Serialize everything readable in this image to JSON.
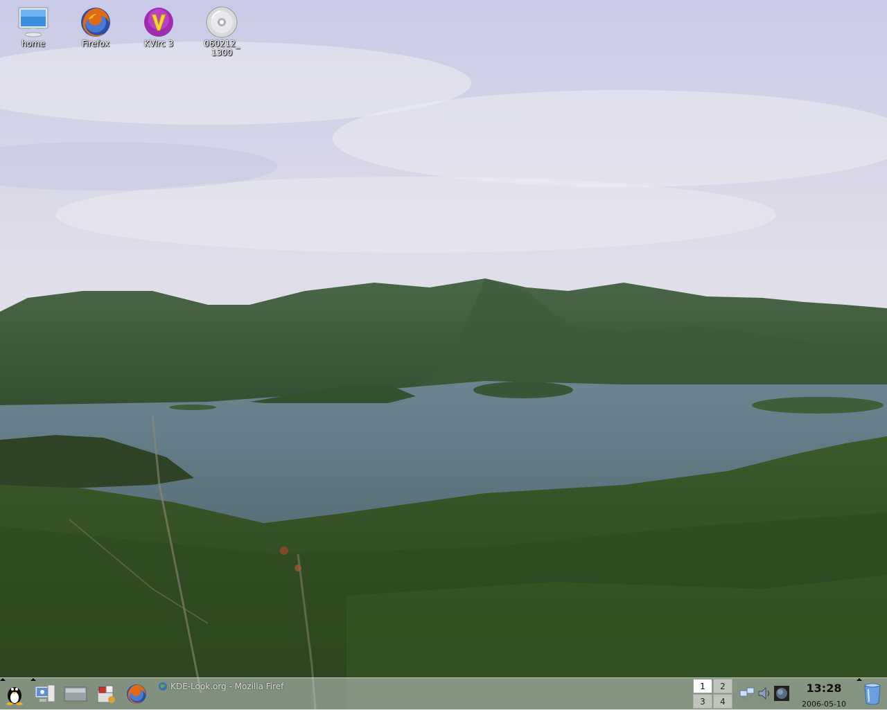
{
  "desktop": {
    "icons": [
      {
        "label": "home",
        "icon": "computer-monitor-icon"
      },
      {
        "label": "Firefox",
        "icon": "firefox-icon"
      },
      {
        "label": "KVIrc 3",
        "icon": "kvirc-icon"
      },
      {
        "label_line1": "060212_",
        "label_line2": "1300",
        "icon": "cdrom-icon"
      }
    ]
  },
  "taskbar": {
    "launchers": [
      "kde-menu-icon",
      "system-settings-icon",
      "desktop-icon",
      "package-manager-icon",
      "firefox-icon"
    ],
    "tasks": [
      {
        "title": "KDE-Look.org - Mozilla Firef",
        "icon": "globe-icon"
      }
    ],
    "pager": {
      "desktops": [
        "1",
        "2",
        "3",
        "4"
      ],
      "active": "1"
    },
    "tray": [
      "network-icon",
      "volume-icon",
      "kweather-icon"
    ],
    "clock": {
      "time": "13:28",
      "date": "2006-05-10"
    },
    "trash": "trash-icon"
  },
  "colors": {
    "taskbar_bg": "#c8cdcd",
    "pager_active": "#ffffff"
  }
}
